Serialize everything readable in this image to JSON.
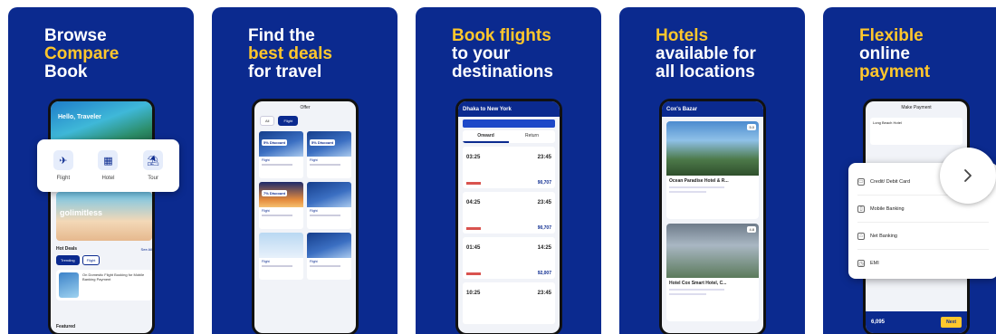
{
  "colors": {
    "brand": "#0b2a8f",
    "accent": "#ffc72c"
  },
  "screenshots": [
    {
      "headline": [
        {
          "text": "Browse",
          "accent": false
        },
        {
          "text": "Compare",
          "accent": true
        },
        {
          "text": "Book",
          "accent": false
        }
      ],
      "screen": {
        "greeting": "Hello, Traveler",
        "categories": [
          {
            "label": "Flight",
            "icon": "flight-icon"
          },
          {
            "label": "Hotel",
            "icon": "hotel-icon"
          },
          {
            "label": "Tour",
            "icon": "tour-icon"
          }
        ],
        "banner": "golimitless",
        "hot_deals": "Hot Deals",
        "see_all": "See All",
        "tabs": [
          "Trending",
          "Flight"
        ],
        "deal_text": "On Domestic Flight Booking for Mobile Banking Payment",
        "featured": "Featured"
      }
    },
    {
      "headline": [
        {
          "text": "Find the",
          "accent": false
        },
        {
          "text": "best deals",
          "accent": true
        },
        {
          "text": "for travel",
          "accent": false
        }
      ],
      "screen": {
        "title": "Offer",
        "tabs": [
          "All",
          "Flight"
        ],
        "cards": [
          {
            "badge": "5% Discount",
            "tag": "Flight"
          },
          {
            "badge": "5% Discount",
            "tag": "Flight"
          },
          {
            "badge": "7% Discount",
            "tag": "Flight"
          },
          {
            "badge": "",
            "tag": "Flight"
          },
          {
            "badge": "",
            "tag": "Flight"
          },
          {
            "badge": "",
            "tag": "Flight"
          }
        ]
      }
    },
    {
      "headline": [
        {
          "text": "Book flights",
          "accent": true
        },
        {
          "text": "to your",
          "accent": false
        },
        {
          "text": "destinations",
          "accent": false
        }
      ],
      "screen": {
        "route": "Dhaka  to  New York",
        "tabs": [
          "Onward",
          "Return"
        ],
        "flights": [
          {
            "dep": "03:25",
            "arr": "23:45",
            "price": "90,707"
          },
          {
            "dep": "04:25",
            "arr": "23:45",
            "price": "90,707"
          },
          {
            "dep": "01:45",
            "arr": "14:25",
            "price": "92,007"
          },
          {
            "dep": "10:25",
            "arr": "23:45",
            "price": ""
          }
        ]
      }
    },
    {
      "headline": [
        {
          "text": "Hotels",
          "accent": true
        },
        {
          "text": "available for",
          "accent": false
        },
        {
          "text": "all locations",
          "accent": false
        }
      ],
      "screen": {
        "title": "Cox's Bazar",
        "hotels": [
          {
            "name": "Ocean Paradise Hotel & R...",
            "rating": "5.0"
          },
          {
            "name": "Hotel Cox Smart Hotel, C...",
            "rating": "4.8"
          }
        ]
      }
    },
    {
      "headline": [
        {
          "text": "Flexible",
          "accent": true
        },
        {
          "text": "online",
          "accent": false
        },
        {
          "text": "payment",
          "accent": true
        }
      ],
      "screen": {
        "title": "Make Payment",
        "hotel": "Long Beach Hotel",
        "methods": [
          {
            "label": "Credit/ Debit Card",
            "icon": "card-icon"
          },
          {
            "label": "Mobile Banking",
            "icon": "mobile-icon"
          },
          {
            "label": "Net Banking",
            "icon": "bank-icon"
          },
          {
            "label": "EMI",
            "icon": "emi-icon"
          }
        ],
        "total": "6,095",
        "pay_button": "Next"
      }
    }
  ]
}
